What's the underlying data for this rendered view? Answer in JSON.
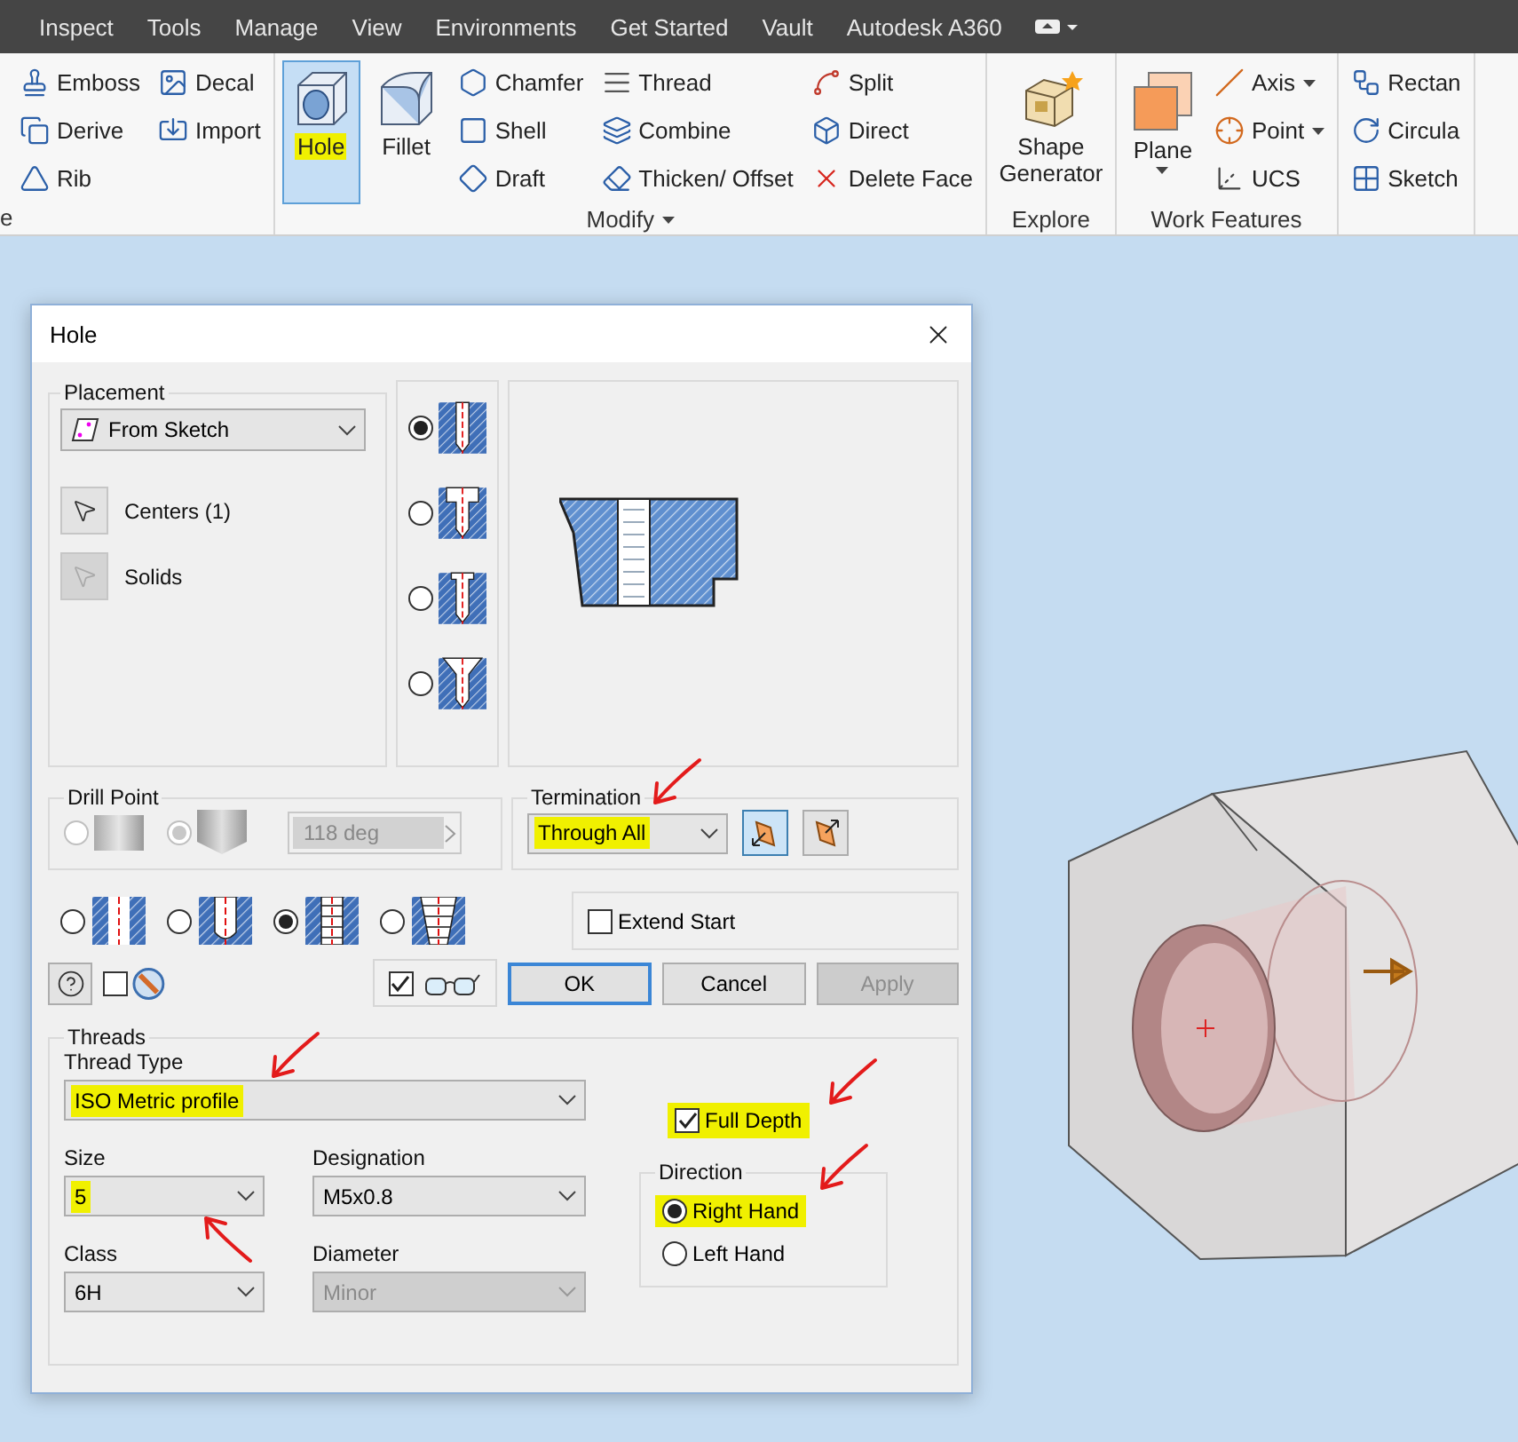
{
  "menu_bar": {
    "items": [
      "Inspect",
      "Tools",
      "Manage",
      "View",
      "Environments",
      "Get Started",
      "Vault",
      "Autodesk A360"
    ]
  },
  "ribbon": {
    "groups": [
      {
        "label": "e",
        "columns": [
          {
            "kind": "stack",
            "buttons": [
              {
                "label": "Emboss",
                "selected": false
              },
              {
                "label": "Derive",
                "selected": false
              },
              {
                "label": "Rib",
                "selected": false
              }
            ]
          },
          {
            "kind": "stack",
            "buttons": [
              {
                "label": "Decal",
                "selected": false
              },
              {
                "label": "Import",
                "selected": false
              }
            ]
          }
        ]
      },
      {
        "label": "Modify",
        "dropdown": true,
        "columns": [
          {
            "kind": "large",
            "buttons": [
              {
                "label": "Hole",
                "selected": true,
                "highlighted": true
              }
            ]
          },
          {
            "kind": "large",
            "buttons": [
              {
                "label": "Fillet",
                "selected": false
              }
            ]
          },
          {
            "kind": "stack",
            "buttons": [
              {
                "label": "Chamfer",
                "selected": false
              },
              {
                "label": "Shell",
                "selected": false
              },
              {
                "label": "Draft",
                "selected": false
              }
            ]
          },
          {
            "kind": "stack",
            "buttons": [
              {
                "label": "Thread",
                "selected": false
              },
              {
                "label": "Combine",
                "selected": false
              },
              {
                "label": "Thicken/ Offset",
                "selected": false
              }
            ]
          },
          {
            "kind": "stack",
            "buttons": [
              {
                "label": "Split",
                "selected": false
              },
              {
                "label": "Direct",
                "selected": false
              },
              {
                "label": "Delete Face",
                "selected": false
              }
            ]
          }
        ]
      },
      {
        "label": "Explore",
        "columns": [
          {
            "kind": "large",
            "buttons": [
              {
                "label": "Shape Generator",
                "selected": false
              }
            ]
          }
        ]
      },
      {
        "label": "Work Features",
        "columns": [
          {
            "kind": "large",
            "buttons": [
              {
                "label": "Plane",
                "selected": false,
                "caret": true
              }
            ]
          },
          {
            "kind": "stack",
            "buttons": [
              {
                "label": "Axis",
                "selected": false,
                "caret": true
              },
              {
                "label": "Point",
                "selected": false,
                "caret": true
              },
              {
                "label": "UCS",
                "selected": false
              }
            ]
          }
        ]
      },
      {
        "columns": [
          {
            "kind": "stack",
            "buttons": [
              {
                "label": "Rectan",
                "selected": false
              },
              {
                "label": "Circula",
                "selected": false
              },
              {
                "label": "Sketch",
                "selected": false
              }
            ]
          }
        ]
      }
    ]
  },
  "dialog": {
    "title": "Hole",
    "placement": {
      "title": "Placement",
      "source": "From Sketch",
      "selectors": [
        {
          "label": "Centers (1)",
          "disabled": false
        },
        {
          "label": "Solids",
          "disabled": true
        }
      ]
    },
    "hole_types": [
      {
        "kind": "simple",
        "selected": true
      },
      {
        "kind": "counterbore",
        "selected": false
      },
      {
        "kind": "spotface",
        "selected": false
      },
      {
        "kind": "countersink",
        "selected": false
      }
    ],
    "drill_point": {
      "title": "Drill Point",
      "disabled": true,
      "options": [
        {
          "kind": "flat",
          "selected": false
        },
        {
          "kind": "angle",
          "selected": true
        }
      ],
      "angle": "118 deg"
    },
    "termination": {
      "title": "Termination",
      "value": "Through All",
      "highlighted": true,
      "annotated": true,
      "directions": [
        {
          "selected": true
        },
        {
          "selected": false
        }
      ]
    },
    "thread_styles": [
      {
        "kind": "drilled",
        "selected": false
      },
      {
        "kind": "clearance",
        "selected": false
      },
      {
        "kind": "tapped",
        "selected": true
      },
      {
        "kind": "taper",
        "selected": false
      }
    ],
    "extend_start": {
      "label": "Extend Start",
      "checked": false
    },
    "footer": {
      "infer_checked": false,
      "preview_checked": true,
      "buttons": [
        {
          "label": "OK",
          "default": true,
          "disabled": false
        },
        {
          "label": "Cancel",
          "default": false,
          "disabled": false
        },
        {
          "label": "Apply",
          "default": false,
          "disabled": true
        }
      ]
    },
    "threads": {
      "title": "Threads",
      "thread_type": {
        "label": "Thread Type",
        "value": "ISO Metric profile",
        "highlighted": true,
        "annotated": true
      },
      "full_depth": {
        "label": "Full Depth",
        "checked": true,
        "highlighted": true,
        "annotated": true
      },
      "size": {
        "label": "Size",
        "value": "5",
        "highlighted": true,
        "annotated": true
      },
      "designation": {
        "label": "Designation",
        "value": "M5x0.8"
      },
      "class": {
        "label": "Class",
        "value": "6H"
      },
      "diameter": {
        "label": "Diameter",
        "value": "Minor",
        "disabled": true
      },
      "direction": {
        "title": "Direction",
        "options": [
          {
            "label": "Right Hand",
            "selected": true,
            "highlighted": true,
            "annotated": true
          },
          {
            "label": "Left Hand",
            "selected": false
          }
        ]
      }
    }
  }
}
